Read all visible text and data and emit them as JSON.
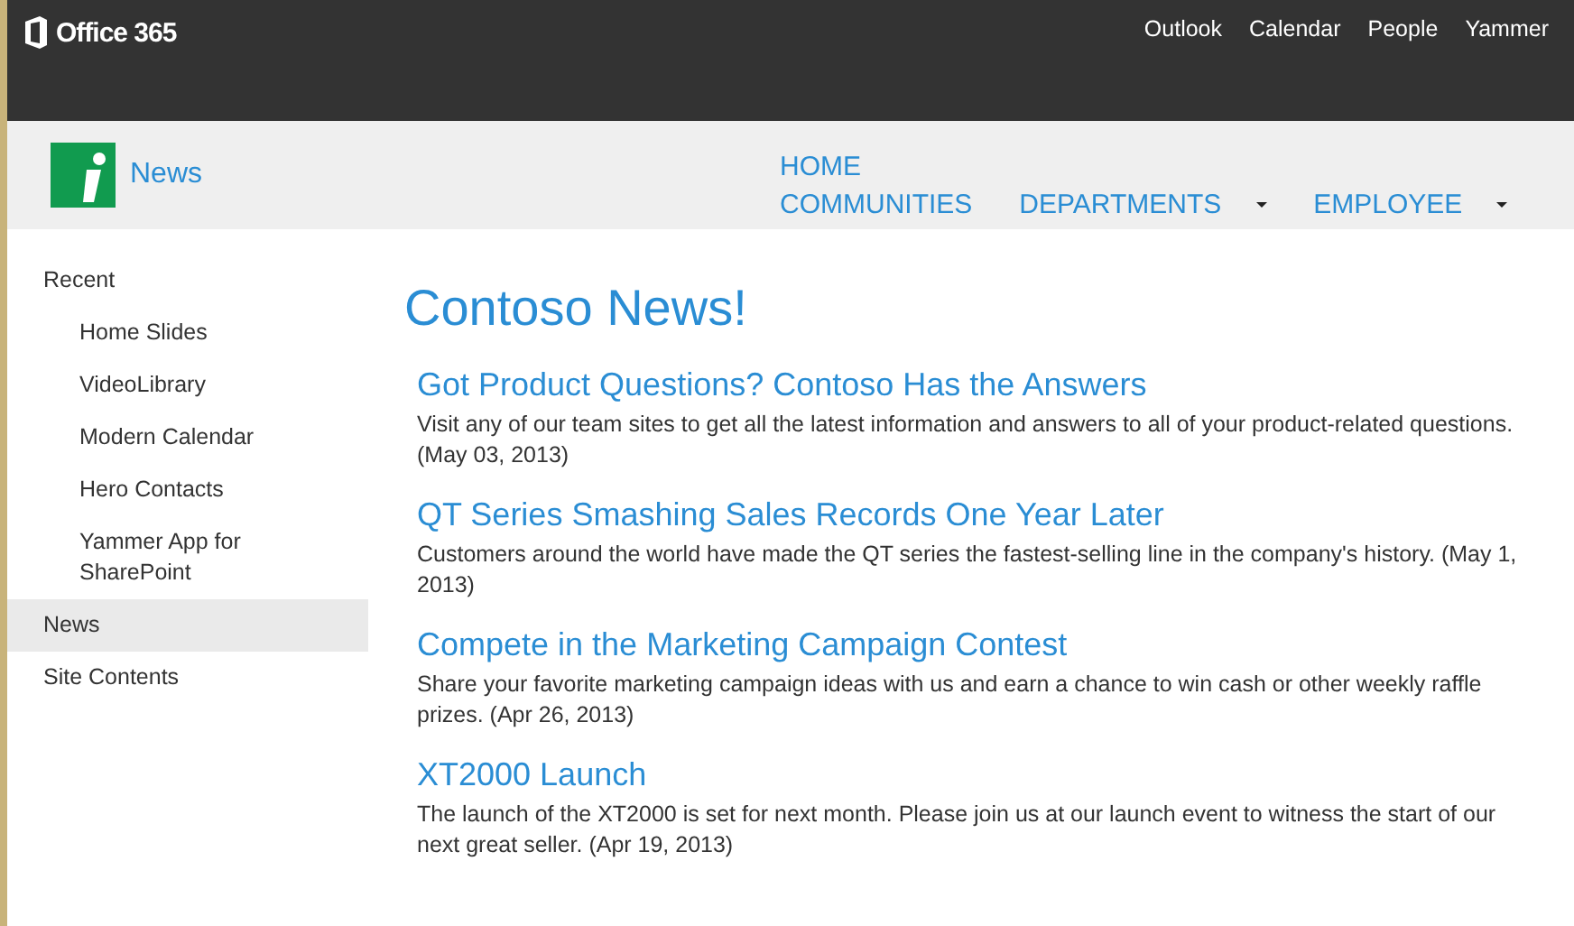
{
  "suite_bar": {
    "brand": "Office 365",
    "links": [
      "Outlook",
      "Calendar",
      "People",
      "Yammer"
    ]
  },
  "site": {
    "title": "News"
  },
  "top_nav": {
    "first_row": [
      {
        "label": "HOME",
        "dropdown": false
      }
    ],
    "second_row": [
      {
        "label": "COMMUNITIES",
        "dropdown": false
      },
      {
        "label": "DEPARTMENTS",
        "dropdown": true
      },
      {
        "label": "EMPLOYEE",
        "dropdown": true
      }
    ]
  },
  "sidebar": {
    "items": [
      {
        "label": "Recent",
        "selected": false,
        "children": [
          {
            "label": "Home Slides",
            "selected": false
          },
          {
            "label": "VideoLibrary",
            "selected": false
          },
          {
            "label": "Modern Calendar",
            "selected": false
          },
          {
            "label": "Hero Contacts",
            "selected": false
          },
          {
            "label": "Yammer App for SharePoint",
            "selected": false
          }
        ]
      },
      {
        "label": "News",
        "selected": true
      },
      {
        "label": "Site Contents",
        "selected": false
      }
    ]
  },
  "page_title": "Contoso News!",
  "articles": [
    {
      "title": "Got Product Questions? Contoso Has the Answers",
      "summary": "Visit any of our team sites to get all the latest information and answers to all of your product-related questions. (May 03, 2013)"
    },
    {
      "title": "QT Series Smashing Sales Records One Year Later",
      "summary": "Customers around the world have made the QT series the fastest-selling line in the company's history. (May 1, 2013)"
    },
    {
      "title": "Compete in the Marketing Campaign Contest",
      "summary": "Share your favorite marketing campaign ideas with us and earn a chance to win cash or other weekly raffle prizes. (Apr 26, 2013)"
    },
    {
      "title": "XT2000 Launch",
      "summary": "The launch of the XT2000 is set for next month. Please join us at our launch event to witness the start of our next great seller. (Apr 19, 2013)"
    }
  ]
}
